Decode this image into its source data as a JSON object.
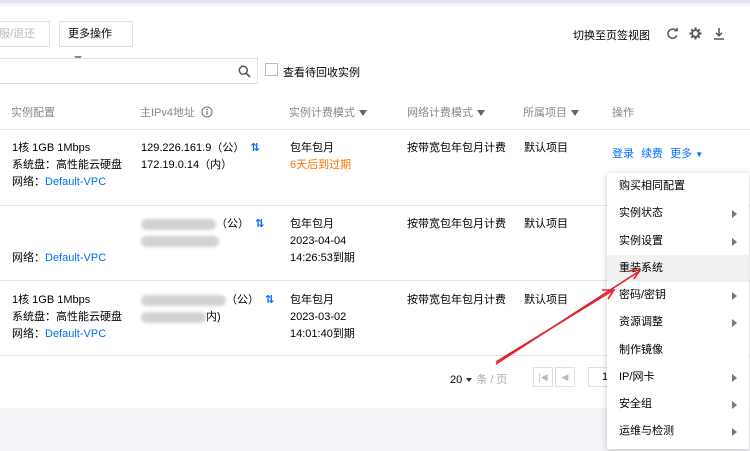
{
  "toolbar": {
    "partial_button_label": "服/退还",
    "more_actions_label": "更多操作",
    "switch_view_label": "切换至页签视图",
    "refresh_icon": "refresh-icon",
    "settings_icon": "gear-icon",
    "download_icon": "download-icon"
  },
  "search": {
    "placeholder": "",
    "recycle_checkbox_label": "查看待回收实例"
  },
  "table": {
    "columns": {
      "config": "实例配置",
      "ipv4": "主IPv4地址",
      "billing": "实例计费模式",
      "network_billing": "网络计费模式",
      "project": "所属项目",
      "actions": "操作"
    },
    "rows": [
      {
        "config_line1": "1核 1GB 1Mbps",
        "config_line2": "系统盘：高性能云硬盘",
        "network_label": "网络：",
        "network_link": "Default-VPC",
        "ip_public": "129.226.161.9（公）",
        "ip_private": "172.19.0.14（内）",
        "billing_mode": "包年包月",
        "billing_note": "6天后到过期",
        "network_billing": "按带宽包年包月计费",
        "project": "默认项目",
        "action_login": "登录",
        "action_renew": "续费",
        "action_more": "更多"
      },
      {
        "network_label": "网络：",
        "network_link": "Default-VPC",
        "ip_public_suffix": "（公）",
        "billing_mode": "包年包月",
        "billing_date": "2023-04-04",
        "billing_expire": "14:26:53到期",
        "network_billing": "按带宽包年包月计费",
        "project": "默认项目"
      },
      {
        "config_line1": "1核 1GB 1Mbps",
        "config_line2": "系统盘：高性能云硬盘",
        "network_label": "网络：",
        "network_link": "Default-VPC",
        "ip_public_suffix": "（公）",
        "ip_private_suffix": "内)",
        "billing_mode": "包年包月",
        "billing_date": "2023-03-02",
        "billing_expire": "14:01:40到期",
        "network_billing": "按带宽包年包月计费",
        "project": "默认项目"
      }
    ]
  },
  "pagination": {
    "page_size": "20",
    "page_size_unit": "条 / 页",
    "first_page_icon": "first-page-icon",
    "prev_page_icon": "prev-page-icon",
    "current_page": "1"
  },
  "dropdown_menu": {
    "items": [
      {
        "label": "购买相同配置",
        "submenu": false
      },
      {
        "label": "实例状态",
        "submenu": true
      },
      {
        "label": "实例设置",
        "submenu": true
      },
      {
        "label": "重装系统",
        "submenu": false,
        "highlighted": true
      },
      {
        "label": "密码/密钥",
        "submenu": true
      },
      {
        "label": "资源调整",
        "submenu": true
      },
      {
        "label": "制作镜像",
        "submenu": false
      },
      {
        "label": "IP/网卡",
        "submenu": true
      },
      {
        "label": "安全组",
        "submenu": true
      },
      {
        "label": "运维与检测",
        "submenu": true
      }
    ]
  },
  "colors": {
    "link_blue": "#006eff",
    "warning_orange": "#ff7200",
    "annotation_red": "#e0242b"
  }
}
